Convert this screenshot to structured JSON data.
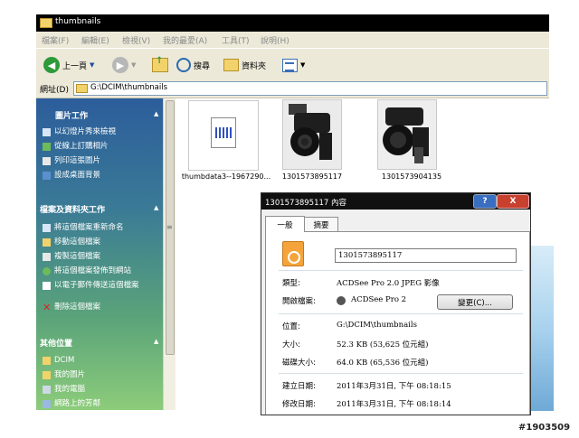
{
  "window": {
    "title": "thumbnails"
  },
  "menu": [
    "檔案(F)",
    "編輯(E)",
    "檢視(V)",
    "我的最愛(A)",
    "工具(T)",
    "說明(H)"
  ],
  "toolbar": {
    "back_label": "上一頁",
    "search_label": "搜尋",
    "folders_label": "資料夾"
  },
  "address": {
    "label": "網址(D)",
    "value": "G:\\DCIM\\thumbnails"
  },
  "left_panel": {
    "picture_tasks": {
      "title": "圖片工作",
      "items": [
        "以幻燈片秀來檢視",
        "從線上訂購相片",
        "列印這張圖片",
        "設成桌面背景"
      ]
    },
    "file_tasks": {
      "title": "檔案及資料夾工作",
      "items": [
        "將這個檔案重新命名",
        "移動這個檔案",
        "複製這個檔案",
        "將這個檔案發佈到網站",
        "以電子郵件傳送這個檔案",
        "刪除這個檔案"
      ]
    },
    "other_places": {
      "title": "其他位置",
      "items": [
        "DCIM",
        "我的圖片",
        "我的電腦",
        "網路上的芳鄰"
      ]
    }
  },
  "files": [
    {
      "name": "thumbdata3--1967290..."
    },
    {
      "name": "1301573895117"
    },
    {
      "name": "1301573904135"
    }
  ],
  "dialog": {
    "title": "1301573895117 內容",
    "tabs": [
      "一般",
      "摘要"
    ],
    "filename": "1301573895117",
    "type_label": "類型:",
    "type_value": "ACDSee Pro 2.0 JPEG 影像",
    "open_label": "開啟檔案:",
    "open_value": "ACDSee Pro 2",
    "change_button": "變更(C)...",
    "location_label": "位置:",
    "location_value": "G:\\DCIM\\thumbnails",
    "size_label": "大小:",
    "size_value": "52.3 KB (53,625 位元組)",
    "disk_label": "磁碟大小:",
    "disk_value": "64.0 KB (65,536 位元組)",
    "created_label": "建立日期:",
    "created_value": "2011年3月31日, 下午 08:18:15",
    "modified_label": "修改日期:",
    "modified_value": "2011年3月31日, 下午 08:18:14",
    "help_button": "?",
    "close_button": "X"
  },
  "watermark": "#1903509",
  "colors": {
    "titlebar": "#000000",
    "panel_top": "#2c5d9b",
    "panel_bottom": "#8ccc7a",
    "dialog_bg": "#f0f0f0"
  }
}
